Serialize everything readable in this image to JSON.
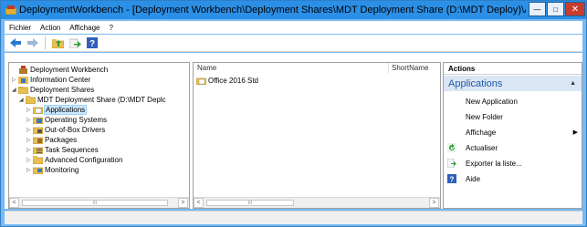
{
  "window": {
    "title": "DeploymentWorkbench - [Deployment Workbench\\Deployment Shares\\MDT Deployment Share (D:\\MDT Deploy)\\A...",
    "min_label": "—",
    "max_label": "□",
    "close_label": "✕"
  },
  "menu": {
    "items": [
      {
        "label": "Fichier"
      },
      {
        "label": "Action"
      },
      {
        "label": "Affichage"
      },
      {
        "label": "?"
      }
    ]
  },
  "toolbar": {
    "icons": [
      "back-icon",
      "forward-icon",
      "up-folder-icon",
      "export-icon",
      "help-icon"
    ]
  },
  "tree": {
    "items": [
      {
        "label": "Deployment Workbench",
        "expander": "",
        "icon": "workbench-icon"
      },
      {
        "label": "Information Center",
        "expander": "▷",
        "icon": "info-center-icon"
      },
      {
        "label": "Deployment Shares",
        "expander": "◢",
        "icon": "folder-open-icon"
      },
      {
        "label": "MDT Deployment Share (D:\\MDT Deplc",
        "expander": "◢",
        "icon": "share-icon"
      },
      {
        "label": "Applications",
        "expander": "▷",
        "icon": "folder-app-icon",
        "selected": true
      },
      {
        "label": "Operating Systems",
        "expander": "▷",
        "icon": "folder-os-icon"
      },
      {
        "label": "Out-of-Box Drivers",
        "expander": "▷",
        "icon": "folder-drivers-icon"
      },
      {
        "label": "Packages",
        "expander": "▷",
        "icon": "folder-packages-icon"
      },
      {
        "label": "Task Sequences",
        "expander": "▷",
        "icon": "folder-tasks-icon"
      },
      {
        "label": "Advanced Configuration",
        "expander": "▷",
        "icon": "folder-config-icon"
      },
      {
        "label": "Monitoring",
        "expander": "▷",
        "icon": "folder-monitor-icon"
      }
    ],
    "scroll_thumb_label": "III"
  },
  "list": {
    "columns": [
      "Name",
      "ShortName"
    ],
    "rows": [
      {
        "name": "Office 2016 Std",
        "shortname": ""
      }
    ],
    "scroll_thumb_label": "III"
  },
  "actions": {
    "header": "Actions",
    "section": "Applications",
    "items": [
      {
        "label": "New Application",
        "icon": ""
      },
      {
        "label": "New Folder",
        "icon": ""
      },
      {
        "label": "Affichage",
        "icon": "",
        "submenu": true
      },
      {
        "label": "Actualiser",
        "icon": "refresh-icon"
      },
      {
        "label": "Exporter la liste...",
        "icon": "export-list-icon"
      },
      {
        "label": "Aide",
        "icon": "help-icon"
      }
    ]
  },
  "colors": {
    "titlebar": "#2b8fe6",
    "frame": "#7ab9f0",
    "selection": "#cce8ff",
    "action_section_bg": "#dbe6f4",
    "action_section_text": "#1e5aa8",
    "close_button": "#c83c2b"
  }
}
